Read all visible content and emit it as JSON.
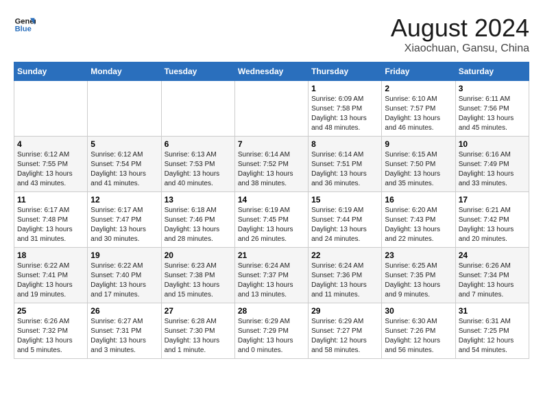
{
  "header": {
    "logo_line1": "General",
    "logo_line2": "Blue",
    "month_title": "August 2024",
    "subtitle": "Xiaochuan, Gansu, China"
  },
  "weekdays": [
    "Sunday",
    "Monday",
    "Tuesday",
    "Wednesday",
    "Thursday",
    "Friday",
    "Saturday"
  ],
  "weeks": [
    [
      {
        "day": "",
        "info": ""
      },
      {
        "day": "",
        "info": ""
      },
      {
        "day": "",
        "info": ""
      },
      {
        "day": "",
        "info": ""
      },
      {
        "day": "1",
        "info": "Sunrise: 6:09 AM\nSunset: 7:58 PM\nDaylight: 13 hours\nand 48 minutes."
      },
      {
        "day": "2",
        "info": "Sunrise: 6:10 AM\nSunset: 7:57 PM\nDaylight: 13 hours\nand 46 minutes."
      },
      {
        "day": "3",
        "info": "Sunrise: 6:11 AM\nSunset: 7:56 PM\nDaylight: 13 hours\nand 45 minutes."
      }
    ],
    [
      {
        "day": "4",
        "info": "Sunrise: 6:12 AM\nSunset: 7:55 PM\nDaylight: 13 hours\nand 43 minutes."
      },
      {
        "day": "5",
        "info": "Sunrise: 6:12 AM\nSunset: 7:54 PM\nDaylight: 13 hours\nand 41 minutes."
      },
      {
        "day": "6",
        "info": "Sunrise: 6:13 AM\nSunset: 7:53 PM\nDaylight: 13 hours\nand 40 minutes."
      },
      {
        "day": "7",
        "info": "Sunrise: 6:14 AM\nSunset: 7:52 PM\nDaylight: 13 hours\nand 38 minutes."
      },
      {
        "day": "8",
        "info": "Sunrise: 6:14 AM\nSunset: 7:51 PM\nDaylight: 13 hours\nand 36 minutes."
      },
      {
        "day": "9",
        "info": "Sunrise: 6:15 AM\nSunset: 7:50 PM\nDaylight: 13 hours\nand 35 minutes."
      },
      {
        "day": "10",
        "info": "Sunrise: 6:16 AM\nSunset: 7:49 PM\nDaylight: 13 hours\nand 33 minutes."
      }
    ],
    [
      {
        "day": "11",
        "info": "Sunrise: 6:17 AM\nSunset: 7:48 PM\nDaylight: 13 hours\nand 31 minutes."
      },
      {
        "day": "12",
        "info": "Sunrise: 6:17 AM\nSunset: 7:47 PM\nDaylight: 13 hours\nand 30 minutes."
      },
      {
        "day": "13",
        "info": "Sunrise: 6:18 AM\nSunset: 7:46 PM\nDaylight: 13 hours\nand 28 minutes."
      },
      {
        "day": "14",
        "info": "Sunrise: 6:19 AM\nSunset: 7:45 PM\nDaylight: 13 hours\nand 26 minutes."
      },
      {
        "day": "15",
        "info": "Sunrise: 6:19 AM\nSunset: 7:44 PM\nDaylight: 13 hours\nand 24 minutes."
      },
      {
        "day": "16",
        "info": "Sunrise: 6:20 AM\nSunset: 7:43 PM\nDaylight: 13 hours\nand 22 minutes."
      },
      {
        "day": "17",
        "info": "Sunrise: 6:21 AM\nSunset: 7:42 PM\nDaylight: 13 hours\nand 20 minutes."
      }
    ],
    [
      {
        "day": "18",
        "info": "Sunrise: 6:22 AM\nSunset: 7:41 PM\nDaylight: 13 hours\nand 19 minutes."
      },
      {
        "day": "19",
        "info": "Sunrise: 6:22 AM\nSunset: 7:40 PM\nDaylight: 13 hours\nand 17 minutes."
      },
      {
        "day": "20",
        "info": "Sunrise: 6:23 AM\nSunset: 7:38 PM\nDaylight: 13 hours\nand 15 minutes."
      },
      {
        "day": "21",
        "info": "Sunrise: 6:24 AM\nSunset: 7:37 PM\nDaylight: 13 hours\nand 13 minutes."
      },
      {
        "day": "22",
        "info": "Sunrise: 6:24 AM\nSunset: 7:36 PM\nDaylight: 13 hours\nand 11 minutes."
      },
      {
        "day": "23",
        "info": "Sunrise: 6:25 AM\nSunset: 7:35 PM\nDaylight: 13 hours\nand 9 minutes."
      },
      {
        "day": "24",
        "info": "Sunrise: 6:26 AM\nSunset: 7:34 PM\nDaylight: 13 hours\nand 7 minutes."
      }
    ],
    [
      {
        "day": "25",
        "info": "Sunrise: 6:26 AM\nSunset: 7:32 PM\nDaylight: 13 hours\nand 5 minutes."
      },
      {
        "day": "26",
        "info": "Sunrise: 6:27 AM\nSunset: 7:31 PM\nDaylight: 13 hours\nand 3 minutes."
      },
      {
        "day": "27",
        "info": "Sunrise: 6:28 AM\nSunset: 7:30 PM\nDaylight: 13 hours\nand 1 minute."
      },
      {
        "day": "28",
        "info": "Sunrise: 6:29 AM\nSunset: 7:29 PM\nDaylight: 13 hours\nand 0 minutes."
      },
      {
        "day": "29",
        "info": "Sunrise: 6:29 AM\nSunset: 7:27 PM\nDaylight: 12 hours\nand 58 minutes."
      },
      {
        "day": "30",
        "info": "Sunrise: 6:30 AM\nSunset: 7:26 PM\nDaylight: 12 hours\nand 56 minutes."
      },
      {
        "day": "31",
        "info": "Sunrise: 6:31 AM\nSunset: 7:25 PM\nDaylight: 12 hours\nand 54 minutes."
      }
    ]
  ]
}
